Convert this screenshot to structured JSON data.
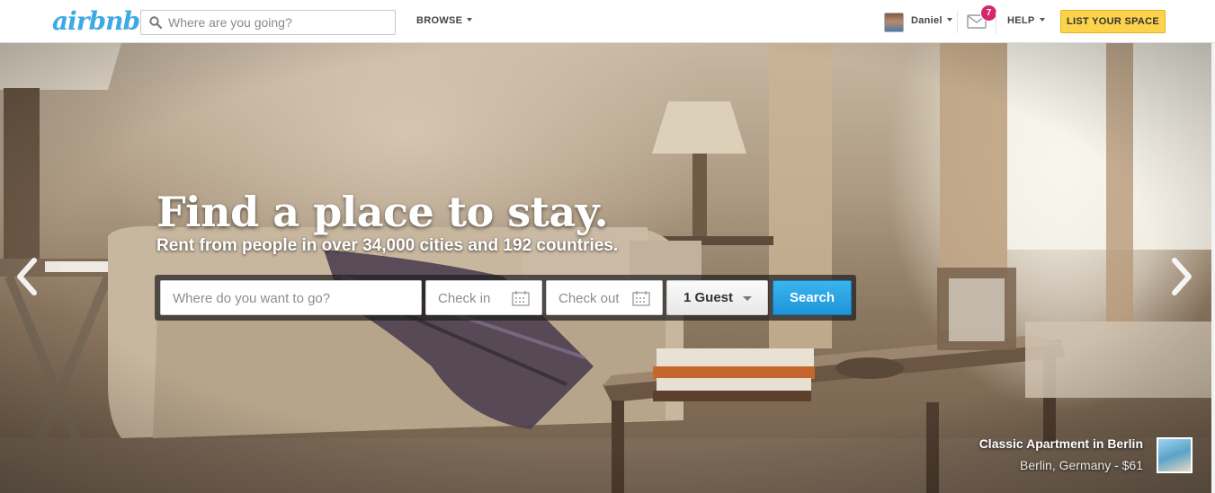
{
  "header": {
    "logo_text": "airbnb",
    "search_placeholder": "Where are you going?",
    "browse_label": "BROWSE",
    "user_name": "Daniel",
    "messages_count": "7",
    "help_label": "HELP",
    "list_space_label": "LIST YOUR SPACE"
  },
  "hero": {
    "headline": "Find a place to stay.",
    "subline": "Rent from people in over 34,000 cities and 192 countries.",
    "search": {
      "location_placeholder": "Where do you want to go?",
      "checkin_placeholder": "Check in",
      "checkout_placeholder": "Check out",
      "guests_value": "1 Guest",
      "search_label": "Search"
    },
    "featured_listing": {
      "title": "Classic Apartment in Berlin",
      "subtitle": "Berlin, Germany - $61"
    }
  },
  "colors": {
    "brand_blue": "#3fa9e6",
    "cta_yellow": "#fcd34a",
    "badge_pink": "#d6266e",
    "search_blue": "#1e94d9"
  },
  "icons": [
    "search-icon",
    "caret-down-icon",
    "mail-icon",
    "calendar-icon",
    "chevron-left-icon",
    "chevron-right-icon"
  ]
}
